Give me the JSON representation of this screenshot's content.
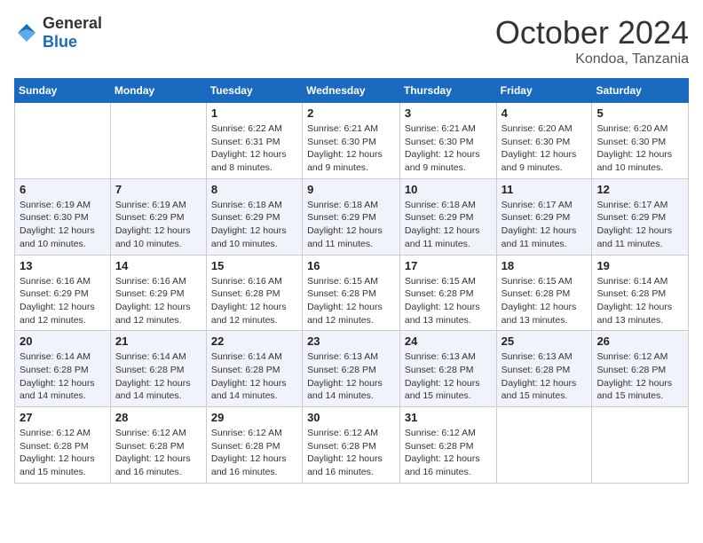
{
  "header": {
    "logo": {
      "general": "General",
      "blue": "Blue"
    },
    "month": "October 2024",
    "location": "Kondoa, Tanzania"
  },
  "weekdays": [
    "Sunday",
    "Monday",
    "Tuesday",
    "Wednesday",
    "Thursday",
    "Friday",
    "Saturday"
  ],
  "weeks": [
    [
      {
        "day": null
      },
      {
        "day": null
      },
      {
        "day": "1",
        "sunrise": "6:22 AM",
        "sunset": "6:31 PM",
        "daylight": "12 hours and 8 minutes."
      },
      {
        "day": "2",
        "sunrise": "6:21 AM",
        "sunset": "6:30 PM",
        "daylight": "12 hours and 9 minutes."
      },
      {
        "day": "3",
        "sunrise": "6:21 AM",
        "sunset": "6:30 PM",
        "daylight": "12 hours and 9 minutes."
      },
      {
        "day": "4",
        "sunrise": "6:20 AM",
        "sunset": "6:30 PM",
        "daylight": "12 hours and 9 minutes."
      },
      {
        "day": "5",
        "sunrise": "6:20 AM",
        "sunset": "6:30 PM",
        "daylight": "12 hours and 10 minutes."
      }
    ],
    [
      {
        "day": "6",
        "sunrise": "6:19 AM",
        "sunset": "6:30 PM",
        "daylight": "12 hours and 10 minutes."
      },
      {
        "day": "7",
        "sunrise": "6:19 AM",
        "sunset": "6:29 PM",
        "daylight": "12 hours and 10 minutes."
      },
      {
        "day": "8",
        "sunrise": "6:18 AM",
        "sunset": "6:29 PM",
        "daylight": "12 hours and 10 minutes."
      },
      {
        "day": "9",
        "sunrise": "6:18 AM",
        "sunset": "6:29 PM",
        "daylight": "12 hours and 11 minutes."
      },
      {
        "day": "10",
        "sunrise": "6:18 AM",
        "sunset": "6:29 PM",
        "daylight": "12 hours and 11 minutes."
      },
      {
        "day": "11",
        "sunrise": "6:17 AM",
        "sunset": "6:29 PM",
        "daylight": "12 hours and 11 minutes."
      },
      {
        "day": "12",
        "sunrise": "6:17 AM",
        "sunset": "6:29 PM",
        "daylight": "12 hours and 11 minutes."
      }
    ],
    [
      {
        "day": "13",
        "sunrise": "6:16 AM",
        "sunset": "6:29 PM",
        "daylight": "12 hours and 12 minutes."
      },
      {
        "day": "14",
        "sunrise": "6:16 AM",
        "sunset": "6:29 PM",
        "daylight": "12 hours and 12 minutes."
      },
      {
        "day": "15",
        "sunrise": "6:16 AM",
        "sunset": "6:28 PM",
        "daylight": "12 hours and 12 minutes."
      },
      {
        "day": "16",
        "sunrise": "6:15 AM",
        "sunset": "6:28 PM",
        "daylight": "12 hours and 12 minutes."
      },
      {
        "day": "17",
        "sunrise": "6:15 AM",
        "sunset": "6:28 PM",
        "daylight": "12 hours and 13 minutes."
      },
      {
        "day": "18",
        "sunrise": "6:15 AM",
        "sunset": "6:28 PM",
        "daylight": "12 hours and 13 minutes."
      },
      {
        "day": "19",
        "sunrise": "6:14 AM",
        "sunset": "6:28 PM",
        "daylight": "12 hours and 13 minutes."
      }
    ],
    [
      {
        "day": "20",
        "sunrise": "6:14 AM",
        "sunset": "6:28 PM",
        "daylight": "12 hours and 14 minutes."
      },
      {
        "day": "21",
        "sunrise": "6:14 AM",
        "sunset": "6:28 PM",
        "daylight": "12 hours and 14 minutes."
      },
      {
        "day": "22",
        "sunrise": "6:14 AM",
        "sunset": "6:28 PM",
        "daylight": "12 hours and 14 minutes."
      },
      {
        "day": "23",
        "sunrise": "6:13 AM",
        "sunset": "6:28 PM",
        "daylight": "12 hours and 14 minutes."
      },
      {
        "day": "24",
        "sunrise": "6:13 AM",
        "sunset": "6:28 PM",
        "daylight": "12 hours and 15 minutes."
      },
      {
        "day": "25",
        "sunrise": "6:13 AM",
        "sunset": "6:28 PM",
        "daylight": "12 hours and 15 minutes."
      },
      {
        "day": "26",
        "sunrise": "6:12 AM",
        "sunset": "6:28 PM",
        "daylight": "12 hours and 15 minutes."
      }
    ],
    [
      {
        "day": "27",
        "sunrise": "6:12 AM",
        "sunset": "6:28 PM",
        "daylight": "12 hours and 15 minutes."
      },
      {
        "day": "28",
        "sunrise": "6:12 AM",
        "sunset": "6:28 PM",
        "daylight": "12 hours and 16 minutes."
      },
      {
        "day": "29",
        "sunrise": "6:12 AM",
        "sunset": "6:28 PM",
        "daylight": "12 hours and 16 minutes."
      },
      {
        "day": "30",
        "sunrise": "6:12 AM",
        "sunset": "6:28 PM",
        "daylight": "12 hours and 16 minutes."
      },
      {
        "day": "31",
        "sunrise": "6:12 AM",
        "sunset": "6:28 PM",
        "daylight": "12 hours and 16 minutes."
      },
      {
        "day": null
      },
      {
        "day": null
      }
    ]
  ],
  "labels": {
    "sunrise": "Sunrise:",
    "sunset": "Sunset:",
    "daylight": "Daylight:"
  }
}
